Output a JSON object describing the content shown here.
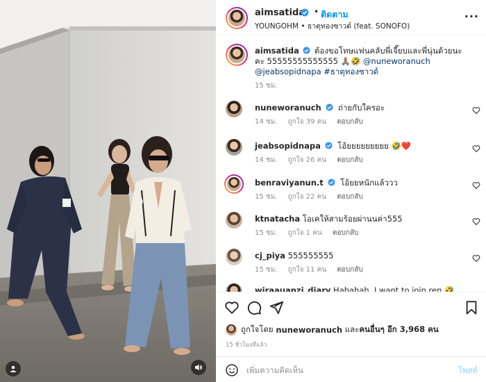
{
  "header": {
    "username": "aimsatida",
    "separator": "•",
    "follow_label": "ติดตาม",
    "music": "YOUNGOHM • ธาตุทองซาวด์ (feat. SONOFO)",
    "more_label": "..."
  },
  "caption": {
    "username": "aimsatida",
    "text": "ต้องขอโทษแฟนคลับพี่เจี๊ยบและพี่นุ่นด้วยนะคะ 55555555555555",
    "emojis": "🙏🏽🤣",
    "mentions": "@nuneworanuch @jeabsopidnapa",
    "hashtag": "#ธาตุทองซาวด์",
    "time": "15 ชม."
  },
  "comments": [
    {
      "username": "nuneworanuch",
      "verified": true,
      "text": "ถ่ายกับใครอะ",
      "time": "14 ชม.",
      "likes": "ถูกใจ 39 คน",
      "reply": "ตอบกลับ"
    },
    {
      "username": "jeabsopidnapa",
      "verified": true,
      "text": "โอ้ยยยยยยยยย 🤣❤️",
      "time": "14 ชม.",
      "likes": "ถูกใจ 26 คน",
      "reply": "ตอบกลับ"
    },
    {
      "username": "benraviyanun.t",
      "verified": true,
      "text": "โอ้ยยหนักแล้ววว",
      "time": "15 ชม.",
      "likes": "ถูกใจ 22 คน",
      "reply": "ตอบกลับ"
    },
    {
      "username": "ktnatacha",
      "verified": false,
      "text": "โอเคให้สามร้อยผ่านนค่า555",
      "time": "15 ชม.",
      "likes": "ถูกใจ 1 คน",
      "reply": "ตอบกลับ"
    },
    {
      "username": "cj_piya",
      "verified": false,
      "text": "555555555",
      "time": "15 ชม.",
      "likes": "ถูกใจ 11 คน",
      "reply": "ตอบกลับ"
    },
    {
      "username": "wiraauanzi_diary",
      "verified": false,
      "text": "Hahahah, I want to join ren 🤣",
      "time": "",
      "likes": "",
      "reply": ""
    }
  ],
  "likes": {
    "prefix": "ถูกใจโดย",
    "user": "nuneworanuch",
    "joiner": "และ",
    "others": "คนอื่นๆ อีก 3,968 คน"
  },
  "timestamp": "15 ชั่วโมงที่แล้ว",
  "composer": {
    "placeholder": "เพิ่มความคิดเห็น",
    "post_label": "โพสต์"
  },
  "icons": {
    "like": "heart-icon",
    "comment": "comment-icon",
    "share": "share-icon",
    "save": "bookmark-icon",
    "emoji": "emoji-icon",
    "verified": "verified-badge-icon",
    "sound": "speaker-icon",
    "tag": "user-tag-icon"
  },
  "colors": {
    "accent": "#0095f6",
    "verified": "#3897f0",
    "muted": "#8e8e8e",
    "post_disabled": "#b2dffc"
  }
}
